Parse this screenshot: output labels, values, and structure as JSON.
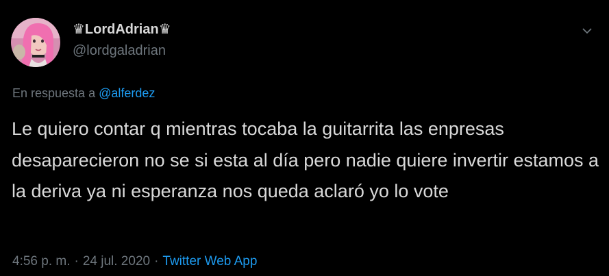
{
  "author": {
    "display_name": "♛LordAdrian♛",
    "handle": "@lordgaladrian",
    "avatar_icon": "profile-avatar"
  },
  "reply": {
    "prefix": "En respuesta a",
    "to": "@alferdez"
  },
  "tweet": {
    "text": "Le quiero contar q mientras tocaba la guitarrita las enpresas desaparecieron no se si esta al día pero nadie quiere invertir estamos a la deriva ya ni esperanza nos queda aclaró yo lo vote"
  },
  "meta": {
    "time": "4:56 p. m.",
    "separator": "·",
    "date": "24 jul. 2020",
    "app": "Twitter Web App"
  },
  "colors": {
    "background": "#000000",
    "text": "#d9d9d9",
    "secondary": "#6e767d",
    "link": "#1d9bf0"
  }
}
